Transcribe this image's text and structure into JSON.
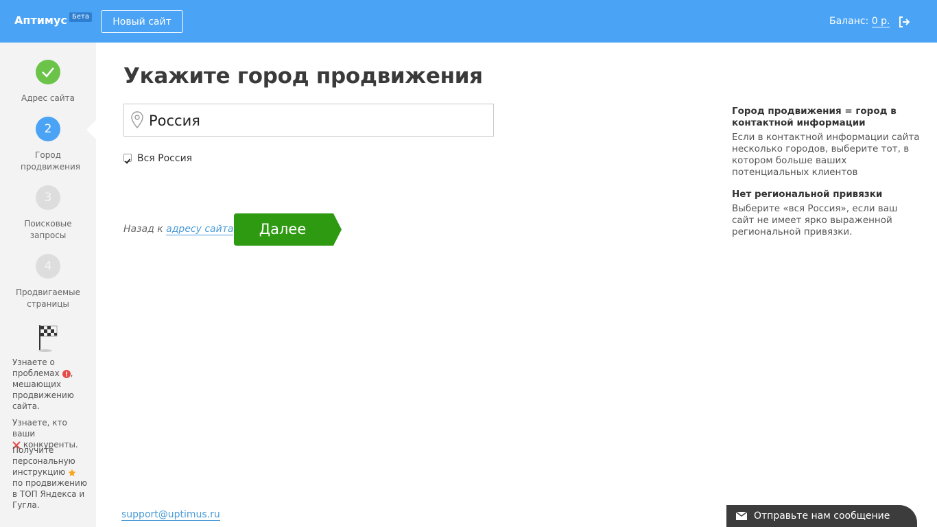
{
  "header": {
    "logo": "Аптимус",
    "beta": "Бета",
    "new_site": "Новый сайт",
    "balance_label": "Баланс:",
    "balance_value": "0 р."
  },
  "sidebar": {
    "steps": [
      {
        "number": "",
        "label": "Адрес сайта",
        "state": "done"
      },
      {
        "number": "2",
        "label": "Город продвижения",
        "state": "active"
      },
      {
        "number": "3",
        "label": "Поисковые запросы",
        "state": "todo"
      },
      {
        "number": "4",
        "label": "Продвигаемые страницы",
        "state": "todo"
      }
    ],
    "notes": [
      {
        "before": "Узнаете о проблемах",
        "after": ", мешающих продвижению сайта.",
        "icon": "alert-icon"
      },
      {
        "before": "Узнаете, кто ваши",
        "after": "конкуренты.",
        "icon": "swords-icon"
      },
      {
        "before": "Получите персональную инструкцию",
        "after": "по продвижению в ТОП Яндекса и Гугла.",
        "icon": "star-icon"
      }
    ]
  },
  "main": {
    "title": "Укажите город продвижения",
    "city_value": "Россия",
    "checkbox_label": "Вся Россия",
    "checkbox_checked": true,
    "back_prefix": "Назад к",
    "back_link": "адресу сайта",
    "next_button": "Далее"
  },
  "info": [
    {
      "heading": "Город продвижения = город в контактной информации",
      "text": "Если в контактной информации сайта несколько городов, выберите тот, в котором больше ваших потенциальных клиентов"
    },
    {
      "heading": "Нет региональной привязки",
      "text": "Выберите «вся Россия», если ваш сайт не имеет ярко выраженной региональной привязки."
    }
  ],
  "footer": {
    "support_email": "support@uptimus.ru",
    "chat_label": "Отправьте нам сообщение"
  },
  "colors": {
    "header": "#4aa3f5",
    "done": "#6bc34a",
    "active": "#4aa3f5",
    "next_button": "#2e9a12",
    "link": "#4a9ad8"
  }
}
